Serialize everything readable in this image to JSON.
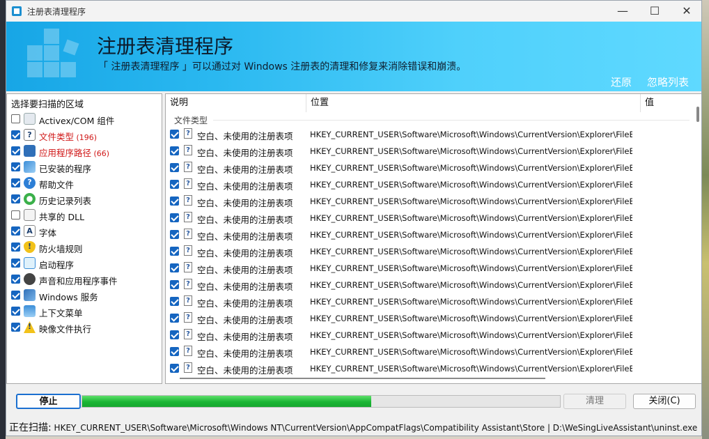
{
  "window": {
    "title": "注册表清理程序"
  },
  "banner": {
    "title": "注册表清理程序",
    "subtitle": "「 注册表清理程序 」可以通过对 Windows 注册表的清理和修复来消除错误和崩溃。",
    "restore_label": "还原",
    "ignore_list_label": "忽略列表",
    "accent": "#29b6f0"
  },
  "scan_areas": {
    "header": "选择要扫描的区域",
    "items": [
      {
        "label": "Activex/COM 组件",
        "count": "",
        "checked": false,
        "icon": "activex-icon",
        "highlight": false
      },
      {
        "label": "文件类型",
        "count": "(196)",
        "checked": true,
        "icon": "file-type-icon",
        "highlight": true
      },
      {
        "label": "应用程序路径",
        "count": "(66)",
        "checked": true,
        "icon": "app-path-icon",
        "highlight": true
      },
      {
        "label": "已安装的程序",
        "count": "",
        "checked": true,
        "icon": "installed-programs-icon",
        "highlight": false
      },
      {
        "label": "帮助文件",
        "count": "",
        "checked": true,
        "icon": "help-icon",
        "highlight": false
      },
      {
        "label": "历史记录列表",
        "count": "",
        "checked": true,
        "icon": "history-icon",
        "highlight": false
      },
      {
        "label": "共享的 DLL",
        "count": "",
        "checked": false,
        "icon": "dll-icon",
        "highlight": false
      },
      {
        "label": "字体",
        "count": "",
        "checked": true,
        "icon": "font-icon",
        "highlight": false
      },
      {
        "label": "防火墙规则",
        "count": "",
        "checked": true,
        "icon": "firewall-icon",
        "highlight": false
      },
      {
        "label": "启动程序",
        "count": "",
        "checked": true,
        "icon": "startup-icon",
        "highlight": false
      },
      {
        "label": "声音和应用程序事件",
        "count": "",
        "checked": true,
        "icon": "sound-icon",
        "highlight": false
      },
      {
        "label": "Windows 服务",
        "count": "",
        "checked": true,
        "icon": "windows-service-icon",
        "highlight": false
      },
      {
        "label": "上下文菜单",
        "count": "",
        "checked": true,
        "icon": "context-menu-icon",
        "highlight": false
      },
      {
        "label": "映像文件执行",
        "count": "",
        "checked": true,
        "icon": "warning-icon",
        "highlight": false
      }
    ]
  },
  "results": {
    "columns": {
      "desc": "说明",
      "location": "位置",
      "value": "值"
    },
    "group_label": "文件类型",
    "rows": [
      {
        "desc": "空白、未使用的注册表项",
        "location": "HKEY_CURRENT_USER\\Software\\Microsoft\\Windows\\CurrentVersion\\Explorer\\FileExts\\.",
        "checked": true
      },
      {
        "desc": "空白、未使用的注册表项",
        "location": "HKEY_CURRENT_USER\\Software\\Microsoft\\Windows\\CurrentVersion\\Explorer\\FileExts...",
        "checked": true
      },
      {
        "desc": "空白、未使用的注册表项",
        "location": "HKEY_CURRENT_USER\\Software\\Microsoft\\Windows\\CurrentVersion\\Explorer\\FileExts...",
        "checked": true
      },
      {
        "desc": "空白、未使用的注册表项",
        "location": "HKEY_CURRENT_USER\\Software\\Microsoft\\Windows\\CurrentVersion\\Explorer\\FileExts...",
        "checked": true
      },
      {
        "desc": "空白、未使用的注册表项",
        "location": "HKEY_CURRENT_USER\\Software\\Microsoft\\Windows\\CurrentVersion\\Explorer\\FileExts...",
        "checked": true
      },
      {
        "desc": "空白、未使用的注册表项",
        "location": "HKEY_CURRENT_USER\\Software\\Microsoft\\Windows\\CurrentVersion\\Explorer\\FileExts...",
        "checked": true
      },
      {
        "desc": "空白、未使用的注册表项",
        "location": "HKEY_CURRENT_USER\\Software\\Microsoft\\Windows\\CurrentVersion\\Explorer\\FileExts...",
        "checked": true
      },
      {
        "desc": "空白、未使用的注册表项",
        "location": "HKEY_CURRENT_USER\\Software\\Microsoft\\Windows\\CurrentVersion\\Explorer\\FileExts...",
        "checked": true
      },
      {
        "desc": "空白、未使用的注册表项",
        "location": "HKEY_CURRENT_USER\\Software\\Microsoft\\Windows\\CurrentVersion\\Explorer\\FileExts...",
        "checked": true
      },
      {
        "desc": "空白、未使用的注册表项",
        "location": "HKEY_CURRENT_USER\\Software\\Microsoft\\Windows\\CurrentVersion\\Explorer\\FileExts...",
        "checked": true
      },
      {
        "desc": "空白、未使用的注册表项",
        "location": "HKEY_CURRENT_USER\\Software\\Microsoft\\Windows\\CurrentVersion\\Explorer\\FileExts...",
        "checked": true
      },
      {
        "desc": "空白、未使用的注册表项",
        "location": "HKEY_CURRENT_USER\\Software\\Microsoft\\Windows\\CurrentVersion\\Explorer\\FileExts...",
        "checked": true
      },
      {
        "desc": "空白、未使用的注册表项",
        "location": "HKEY_CURRENT_USER\\Software\\Microsoft\\Windows\\CurrentVersion\\Explorer\\FileExts...",
        "checked": true
      },
      {
        "desc": "空白、未使用的注册表项",
        "location": "HKEY_CURRENT_USER\\Software\\Microsoft\\Windows\\CurrentVersion\\Explorer\\FileExts...",
        "checked": true
      },
      {
        "desc": "空白、未使用的注册表项",
        "location": "HKEY_CURRENT_USER\\Software\\Microsoft\\Windows\\CurrentVersion\\Explorer\\FileExts...",
        "checked": true
      }
    ]
  },
  "controls": {
    "stop_label": "停止",
    "clean_label": "清理",
    "close_label": "关闭(C)",
    "progress": 0.605
  },
  "status": {
    "label": "正在扫描:",
    "text": "HKEY_CURRENT_USER\\Software\\Microsoft\\Windows NT\\CurrentVersion\\AppCompatFlags\\Compatibility Assistant\\Store | D:\\WeSingLiveAssistant\\uninst.exe"
  }
}
